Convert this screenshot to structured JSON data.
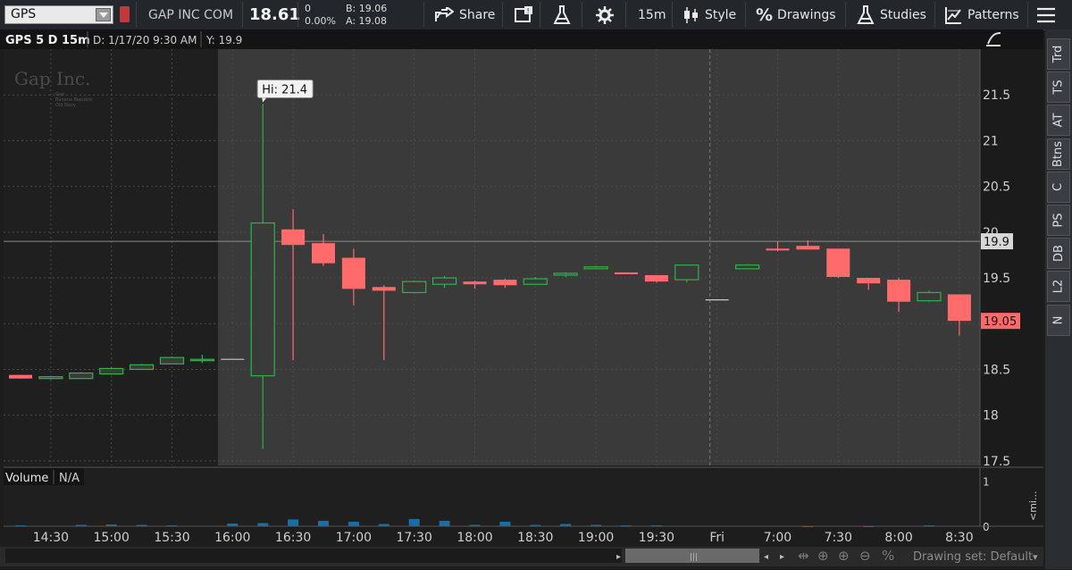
{
  "toolbar": {
    "symbol": "GPS",
    "company": "GAP INC COM",
    "last": "18.61",
    "change": "0",
    "change_pct": "0.00%",
    "bid": "B: 19.06",
    "ask": "A: 19.08",
    "share": "Share",
    "interval": "15m",
    "style": "Style",
    "drawings": "Drawings",
    "studies": "Studies",
    "patterns": "Patterns"
  },
  "header": {
    "title": "GPS 5 D 15m",
    "date": "D: 1/17/20 9:30 AM",
    "y": "Y: 19.9"
  },
  "watermark": {
    "brand": "Gap Inc.",
    "sub1": "Gap",
    "sub2": "Banana Republic",
    "sub3": "Old Navy"
  },
  "hi_label": "Hi: 21.4",
  "price_badge_line": "19.9",
  "price_badge_last": "19.05",
  "volume": {
    "label": "Volume",
    "value": "N/A"
  },
  "right_tabs": [
    "Trd",
    "TS",
    "AT",
    "Btns",
    "C",
    "PS",
    "DB",
    "L2",
    "N"
  ],
  "right_vertical_label": "<mi...",
  "drawing_set": "Drawing set: Default",
  "colors": {
    "up": "#2db34a",
    "down": "#ff6b6b",
    "bg_pre": "#1f1f1f",
    "bg_session": "#3a3a3a",
    "volume": "#1a6ea8"
  },
  "chart_data": {
    "type": "candlestick",
    "title": "GPS 5 D 15m",
    "ylim": [
      17.45,
      22.0
    ],
    "yticks": [
      17.5,
      18,
      18.5,
      19,
      19.5,
      20,
      20.5,
      21,
      21.5
    ],
    "horizontal_line": 19.9,
    "x_labels": [
      {
        "label": "14:30",
        "i": 1
      },
      {
        "label": "15:00",
        "i": 3
      },
      {
        "label": "15:30",
        "i": 5
      },
      {
        "label": "16:00",
        "i": 7
      },
      {
        "label": "16:30",
        "i": 9
      },
      {
        "label": "17:00",
        "i": 11
      },
      {
        "label": "17:30",
        "i": 13
      },
      {
        "label": "18:00",
        "i": 15
      },
      {
        "label": "18:30",
        "i": 17
      },
      {
        "label": "19:00",
        "i": 19
      },
      {
        "label": "19:30",
        "i": 21
      },
      {
        "label": "Fri",
        "i": 23
      },
      {
        "label": "7:00",
        "i": 25
      },
      {
        "label": "7:30",
        "i": 27
      },
      {
        "label": "8:00",
        "i": 29
      },
      {
        "label": "8:30",
        "i": 31
      }
    ],
    "candles": [
      {
        "o": 18.44,
        "h": 18.44,
        "l": 18.4,
        "c": 18.4
      },
      {
        "o": 18.4,
        "h": 18.42,
        "l": 18.39,
        "c": 18.42
      },
      {
        "o": 18.4,
        "h": 18.47,
        "l": 18.4,
        "c": 18.46
      },
      {
        "o": 18.45,
        "h": 18.52,
        "l": 18.45,
        "c": 18.51
      },
      {
        "o": 18.5,
        "h": 18.56,
        "l": 18.5,
        "c": 18.55
      },
      {
        "o": 18.56,
        "h": 18.64,
        "l": 18.56,
        "c": 18.63
      },
      {
        "o": 18.61,
        "h": 18.66,
        "l": 18.57,
        "c": 18.61
      },
      {
        "o": 18.61,
        "h": 18.61,
        "l": 18.61,
        "c": 18.61
      },
      {
        "o": 18.43,
        "h": 21.4,
        "l": 17.63,
        "c": 20.1
      },
      {
        "o": 20.03,
        "h": 20.25,
        "l": 18.6,
        "c": 19.86
      },
      {
        "o": 19.88,
        "h": 19.98,
        "l": 19.63,
        "c": 19.66
      },
      {
        "o": 19.72,
        "h": 19.82,
        "l": 19.2,
        "c": 19.38
      },
      {
        "o": 19.4,
        "h": 19.42,
        "l": 18.6,
        "c": 19.36
      },
      {
        "o": 19.34,
        "h": 19.47,
        "l": 19.33,
        "c": 19.46
      },
      {
        "o": 19.43,
        "h": 19.52,
        "l": 19.39,
        "c": 19.5
      },
      {
        "o": 19.46,
        "h": 19.47,
        "l": 19.38,
        "c": 19.43
      },
      {
        "o": 19.48,
        "h": 19.49,
        "l": 19.39,
        "c": 19.42
      },
      {
        "o": 19.43,
        "h": 19.51,
        "l": 19.43,
        "c": 19.49
      },
      {
        "o": 19.53,
        "h": 19.56,
        "l": 19.51,
        "c": 19.55
      },
      {
        "o": 19.6,
        "h": 19.63,
        "l": 19.6,
        "c": 19.62
      },
      {
        "o": 19.56,
        "h": 19.56,
        "l": 19.54,
        "c": 19.54
      },
      {
        "o": 19.53,
        "h": 19.53,
        "l": 19.45,
        "c": 19.46
      },
      {
        "o": 19.48,
        "h": 19.64,
        "l": 19.45,
        "c": 19.64
      },
      {
        "o": 19.26,
        "h": 19.26,
        "l": 19.26,
        "c": 19.26
      },
      {
        "o": 19.6,
        "h": 19.65,
        "l": 19.6,
        "c": 19.64
      },
      {
        "o": 19.82,
        "h": 19.9,
        "l": 19.79,
        "c": 19.8
      },
      {
        "o": 19.85,
        "h": 19.91,
        "l": 19.81,
        "c": 19.81
      },
      {
        "o": 19.82,
        "h": 19.82,
        "l": 19.5,
        "c": 19.51
      },
      {
        "o": 19.5,
        "h": 19.5,
        "l": 19.37,
        "c": 19.44
      },
      {
        "o": 19.48,
        "h": 19.5,
        "l": 19.13,
        "c": 19.24
      },
      {
        "o": 19.25,
        "h": 19.36,
        "l": 19.24,
        "c": 19.34
      },
      {
        "o": 19.32,
        "h": 19.32,
        "l": 18.87,
        "c": 19.03
      }
    ],
    "volume_ylim": [
      0,
      1.15
    ],
    "volume_yticks": [
      1,
      0
    ],
    "volume": [
      0.02,
      0.01,
      0.03,
      0.04,
      0.03,
      0.02,
      0.01,
      0.06,
      0.07,
      0.15,
      0.12,
      0.1,
      0.05,
      0.16,
      0.12,
      0.03,
      0.1,
      0.03,
      0.05,
      0.03,
      0.02,
      0.02,
      0.01,
      0.01,
      0.01,
      0.01,
      0.0,
      0.01,
      0.0,
      0.01,
      0.02,
      0.01
    ]
  }
}
